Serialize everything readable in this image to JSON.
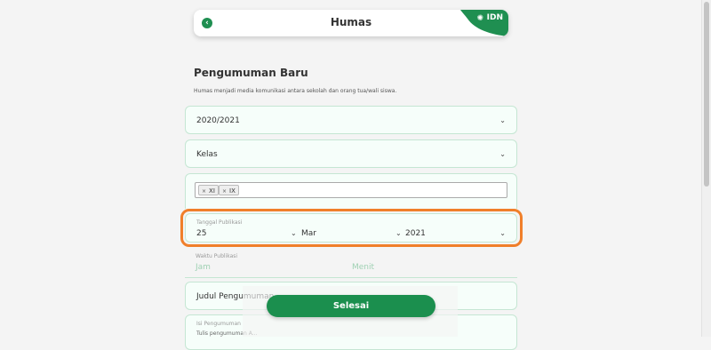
{
  "header": {
    "title": "Humas",
    "logo_text": "IDN",
    "back_icon": "chevron-left"
  },
  "form": {
    "title": "Pengumuman Baru",
    "description": "Humas menjadi media komunikasi antara sekolah dan orang tua/wali siswa.",
    "year_select": {
      "value": "2020/2021"
    },
    "class_select": {
      "value": "Kelas"
    },
    "class_tags": [
      "XI",
      "IX"
    ],
    "publish_date": {
      "label": "Tanggal Publikasi",
      "day": "25",
      "month": "Mar",
      "year": "2021"
    },
    "publish_time": {
      "label": "Waktu Publikasi",
      "hour_placeholder": "Jam",
      "minute_placeholder": "Menit"
    },
    "title_field": {
      "placeholder": "Judul Pengumuman"
    },
    "content_field": {
      "label": "Isi Pengumuman",
      "placeholder": "Tulis pengumuman A..."
    },
    "submit_label": "Selesai"
  },
  "colors": {
    "primary": "#1b8f4e",
    "highlight": "#f07f2a",
    "field_border": "#c5e6d3"
  }
}
